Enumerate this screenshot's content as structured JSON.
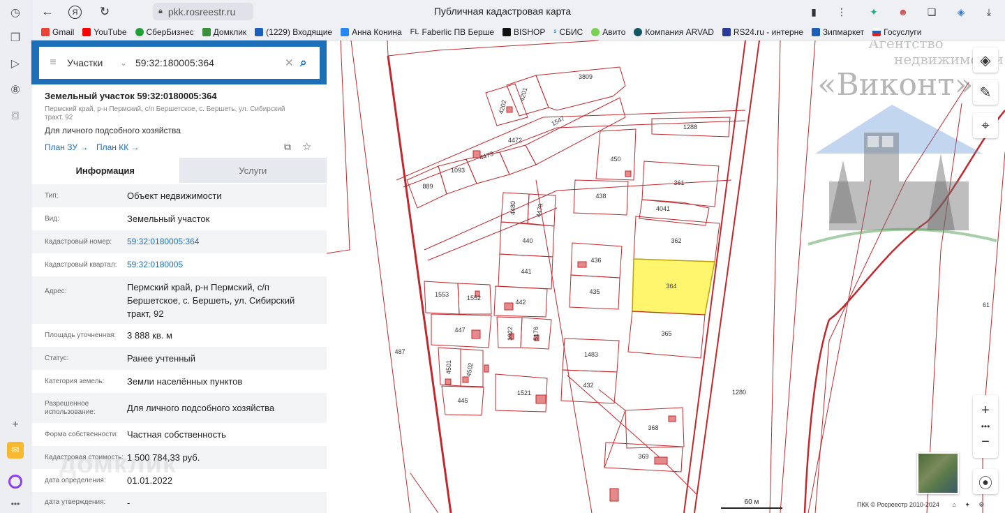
{
  "browser": {
    "url": "pkk.rosreestr.ru",
    "page_title": "Публичная кадастровая карта",
    "bookmarks": [
      "Gmail",
      "YouTube",
      "СберБизнес",
      "Домклик",
      "(1229) Входящие",
      "Анна Конина",
      "Faberlic ПВ Берше",
      "BISHOP",
      "СБИС",
      "Авито",
      "Компания ARVAD",
      "RS24.ru - интерне",
      "Зипмаркет",
      "Госуслуги"
    ]
  },
  "search": {
    "category": "Участки",
    "query": "59:32:180005:364"
  },
  "object": {
    "title": "Земельный участок 59:32:0180005:364",
    "address_short": "Пермский край, р-н Пермский, с/п Бершетское, с. Бершеть, ул. Сибирский тракт, 92",
    "use": "Для личного подсобного хозяйства",
    "plan_zu": "План ЗУ",
    "plan_kk": "План КК"
  },
  "tabs": [
    "Информация",
    "Услуги"
  ],
  "info": [
    {
      "label": "Тип:",
      "value": "Объект недвижимости"
    },
    {
      "label": "Вид:",
      "value": "Земельный участок"
    },
    {
      "label": "Кадастровый номер:",
      "value": "59:32:0180005:364"
    },
    {
      "label": "Кадастровый квартал:",
      "value": "59:32:0180005"
    },
    {
      "label": "Адрес:",
      "value": "Пермский край, р-н Пермский, с/п Бершетское, с. Бершеть, ул. Сибирский тракт, 92"
    },
    {
      "label": "Площадь уточненная:",
      "value": "3 888 кв. м"
    },
    {
      "label": "Статус:",
      "value": "Ранее учтенный"
    },
    {
      "label": "Категория земель:",
      "value": "Земли населённых пунктов"
    },
    {
      "label": "Разрешенное использование:",
      "value": "Для личного подсобного хозяйства"
    },
    {
      "label": "Форма собственности:",
      "value": "Частная собственность"
    },
    {
      "label": "Кадастровая стоимость:",
      "value": "1 500 784,33 руб."
    },
    {
      "label": "дата определения:",
      "value": "01.01.2022"
    },
    {
      "label": "дата утверждения:",
      "value": "-"
    }
  ],
  "panel_watermark": "домклик",
  "map": {
    "parcels": [
      "3809",
      "4201",
      "4202",
      "1547",
      "4472",
      "4473",
      "1093",
      "889",
      "1288",
      "450",
      "361",
      "438",
      "4041",
      "4480",
      "4479",
      "440",
      "362",
      "436",
      "441",
      "364",
      "435",
      "1553",
      "1552",
      "442",
      "447",
      "3922",
      "5176",
      "365",
      "1483",
      "4501",
      "4502",
      "432",
      "445",
      "1521",
      "1280",
      "487",
      "368",
      "369",
      "61"
    ],
    "scale": "60 м",
    "attribution": "ПКК © Росреестр 2010-2024",
    "watermark": {
      "line1": "Агентство",
      "line2": "недвижимости",
      "line3": "«Виконт»"
    },
    "colors": {
      "border": "#c0282d",
      "highlight": "#fff66e"
    }
  }
}
